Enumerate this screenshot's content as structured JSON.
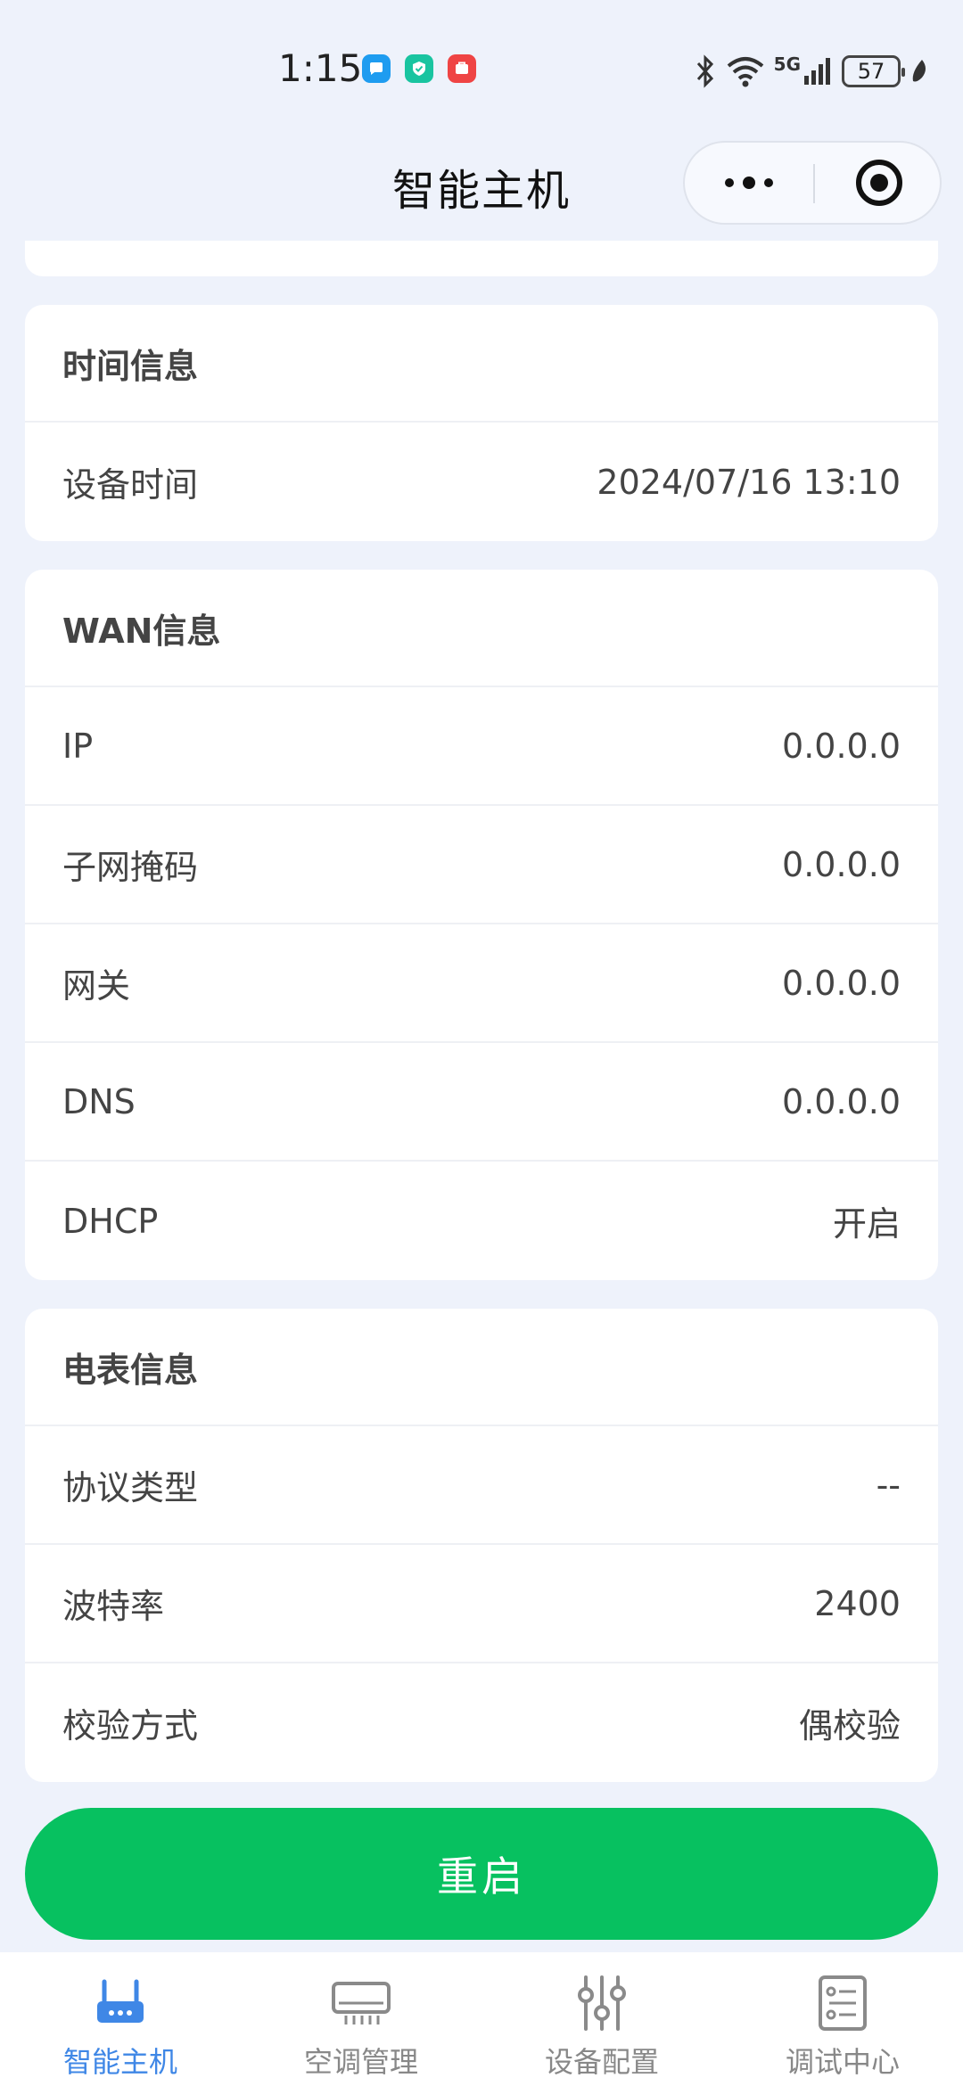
{
  "status_bar": {
    "time": "1:15",
    "network": "5G",
    "battery": "57"
  },
  "navbar": {
    "title": "智能主机"
  },
  "sections": {
    "time_info": {
      "title": "时间信息",
      "rows": [
        {
          "label": "设备时间",
          "value": "2024/07/16 13:10"
        }
      ]
    },
    "wan_info": {
      "title": "WAN信息",
      "rows": [
        {
          "label": "IP",
          "value": "0.0.0.0"
        },
        {
          "label": "子网掩码",
          "value": "0.0.0.0"
        },
        {
          "label": "网关",
          "value": "0.0.0.0"
        },
        {
          "label": "DNS",
          "value": "0.0.0.0"
        },
        {
          "label": "DHCP",
          "value": "开启"
        }
      ]
    },
    "meter_info": {
      "title": "电表信息",
      "rows": [
        {
          "label": "协议类型",
          "value": "--"
        },
        {
          "label": "波特率",
          "value": "2400"
        },
        {
          "label": "校验方式",
          "value": "偶校验"
        }
      ]
    }
  },
  "actions": {
    "restart_label": "重启"
  },
  "tabbar": {
    "items": [
      {
        "label": "智能主机",
        "icon": "router-icon",
        "active": true
      },
      {
        "label": "空调管理",
        "icon": "air-conditioner-icon",
        "active": false
      },
      {
        "label": "设备配置",
        "icon": "sliders-icon",
        "active": false
      },
      {
        "label": "调试中心",
        "icon": "checklist-icon",
        "active": false
      }
    ]
  },
  "colors": {
    "accent": "#07c160",
    "tab_active": "#3f87e6",
    "background": "#eef2fb"
  }
}
